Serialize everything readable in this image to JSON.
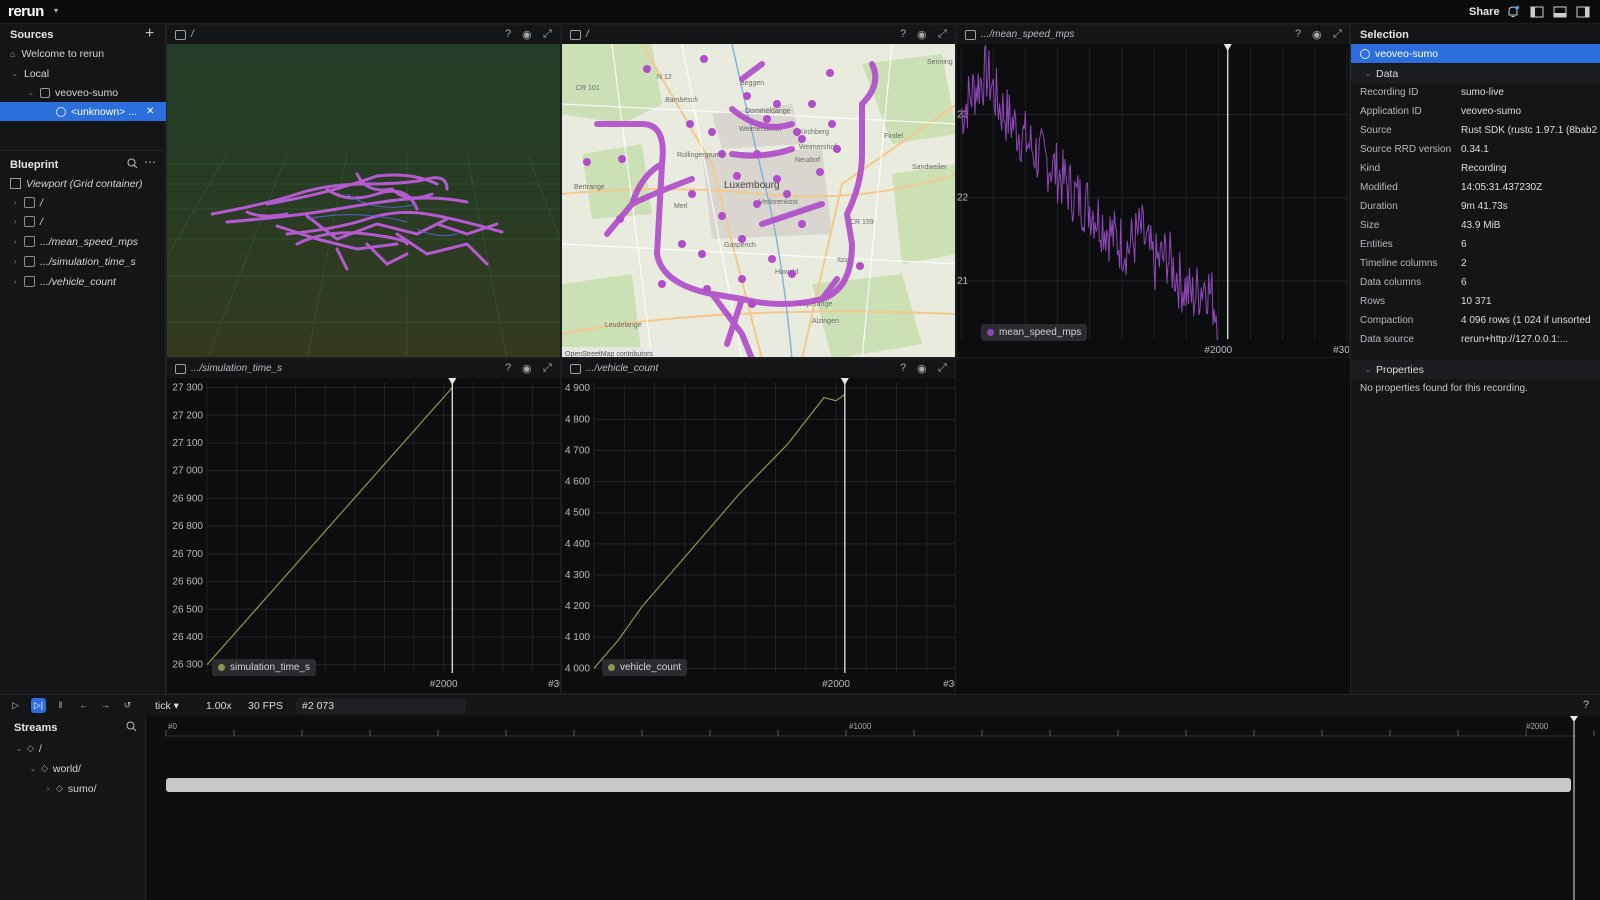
{
  "app": {
    "logo": "rerun",
    "share_label": "Share"
  },
  "sources": {
    "title": "Sources",
    "welcome": "Welcome to rerun",
    "local": "Local",
    "recording": "veoveo-sumo",
    "unknown": "<unknown> ..."
  },
  "blueprint": {
    "title": "Blueprint",
    "viewport": "Viewport (Grid container)",
    "items": [
      "/",
      "/",
      ".../mean_speed_mps",
      ".../simulation_time_s",
      ".../vehicle_count"
    ]
  },
  "views": {
    "v3d": {
      "title": "/"
    },
    "vmap": {
      "title": "/",
      "attribution": "OpenStreetMap contributors",
      "labels": [
        "N 12",
        "CR 101",
        "Beggen",
        "Dommeldange",
        "Bambësch",
        "Weimerskirch",
        "Kirchberg",
        "Findel",
        "Rollingergrund",
        "Weimershof",
        "Neudorf",
        "Sandweiler",
        "Bertrange",
        "Luxembourg",
        "Merl",
        "Verlorenkost",
        "CR 159",
        "Gasperich",
        "Itzig",
        "Howald",
        "Hesperange",
        "Alzingen",
        "Leudelange",
        "Senning"
      ]
    },
    "vspeed": {
      "title": ".../mean_speed_mps",
      "legend": "mean_speed_mps"
    },
    "vsim": {
      "title": ".../simulation_time_s",
      "legend": "simulation_time_s"
    },
    "vcount": {
      "title": ".../vehicle_count",
      "legend": "vehicle_count"
    }
  },
  "chart_data": [
    {
      "type": "line",
      "series": [
        {
          "name": "mean_speed_mps",
          "color": "#8f47b9"
        }
      ],
      "x": [
        0,
        100,
        200,
        300,
        400,
        500,
        600,
        700,
        800,
        900,
        1000,
        1100,
        1200,
        1300,
        1400,
        1500,
        1600,
        1700,
        1800,
        1900,
        2000
      ],
      "values": [
        23.0,
        23.3,
        23.5,
        23.1,
        22.9,
        22.7,
        22.5,
        22.4,
        22.2,
        22.0,
        21.9,
        21.7,
        21.5,
        21.4,
        21.6,
        21.2,
        21.3,
        21.0,
        20.8,
        21.0,
        20.6
      ],
      "ylim": [
        20.3,
        23.8
      ],
      "xlim": [
        0,
        3000
      ],
      "x_ticks": [
        "#2000",
        "#3000"
      ],
      "y_ticks": [
        "23",
        "22",
        "21"
      ],
      "cursor": 2073
    },
    {
      "type": "line",
      "series": [
        {
          "name": "simulation_time_s",
          "color": "#8a9a4f"
        }
      ],
      "x": [
        0,
        2073
      ],
      "values": [
        26300,
        27300
      ],
      "ylim": [
        26270,
        27320
      ],
      "xlim": [
        0,
        3000
      ],
      "x_ticks": [
        "#2000",
        "#3000"
      ],
      "y_ticks": [
        "27 300",
        "27 200",
        "27 100",
        "27 000",
        "26 900",
        "26 800",
        "26 700",
        "26 600",
        "26 500",
        "26 400",
        "26 300"
      ],
      "cursor": 2073
    },
    {
      "type": "line",
      "series": [
        {
          "name": "vehicle_count",
          "color": "#8a9a4f"
        }
      ],
      "x": [
        0,
        200,
        400,
        600,
        800,
        1000,
        1200,
        1400,
        1600,
        1800,
        1900,
        2000,
        2073
      ],
      "values": [
        4000,
        4090,
        4200,
        4290,
        4380,
        4470,
        4560,
        4640,
        4720,
        4820,
        4870,
        4860,
        4880
      ],
      "ylim": [
        3985,
        4920
      ],
      "xlim": [
        0,
        3000
      ],
      "x_ticks": [
        "#2000",
        "#3000"
      ],
      "y_ticks": [
        "4 900",
        "4 800",
        "4 700",
        "4 600",
        "4 500",
        "4 400",
        "4 300",
        "4 200",
        "4 100",
        "4 000"
      ],
      "cursor": 2073
    }
  ],
  "selection": {
    "title": "Selection",
    "selected": "veoveo-sumo",
    "data_header": "Data",
    "rows": [
      {
        "k": "Recording ID",
        "v": "sumo-live"
      },
      {
        "k": "Application ID",
        "v": "veoveo-sumo"
      },
      {
        "k": "Source",
        "v": "Rust SDK (rustc 1.97.1 (8bab2"
      },
      {
        "k": "Source RRD version",
        "v": "0.34.1"
      },
      {
        "k": "Kind",
        "v": "Recording"
      },
      {
        "k": "Modified",
        "v": "14:05:31.437230Z"
      },
      {
        "k": "Duration",
        "v": "9m 41.73s"
      },
      {
        "k": "Size",
        "v": "43.9 MiB"
      },
      {
        "k": "Entities",
        "v": "6"
      },
      {
        "k": "Timeline columns",
        "v": "2"
      },
      {
        "k": "Data columns",
        "v": "6"
      },
      {
        "k": "Rows",
        "v": "10 371"
      },
      {
        "k": "Compaction",
        "v": "4 096 rows (1 024 if unsorted"
      },
      {
        "k": "Data source",
        "v": "rerun+http://127.0.0.1:..."
      }
    ],
    "properties_header": "Properties",
    "properties_empty": "No properties found for this recording."
  },
  "timeline": {
    "timeline_name": "tick",
    "speed": "1.00x",
    "fps": "30 FPS",
    "current": "#2 073",
    "ticks": [
      "#0",
      "#1000",
      "#2000"
    ],
    "streams_title": "Streams",
    "streams": [
      "/",
      "world/",
      "sumo/"
    ]
  }
}
